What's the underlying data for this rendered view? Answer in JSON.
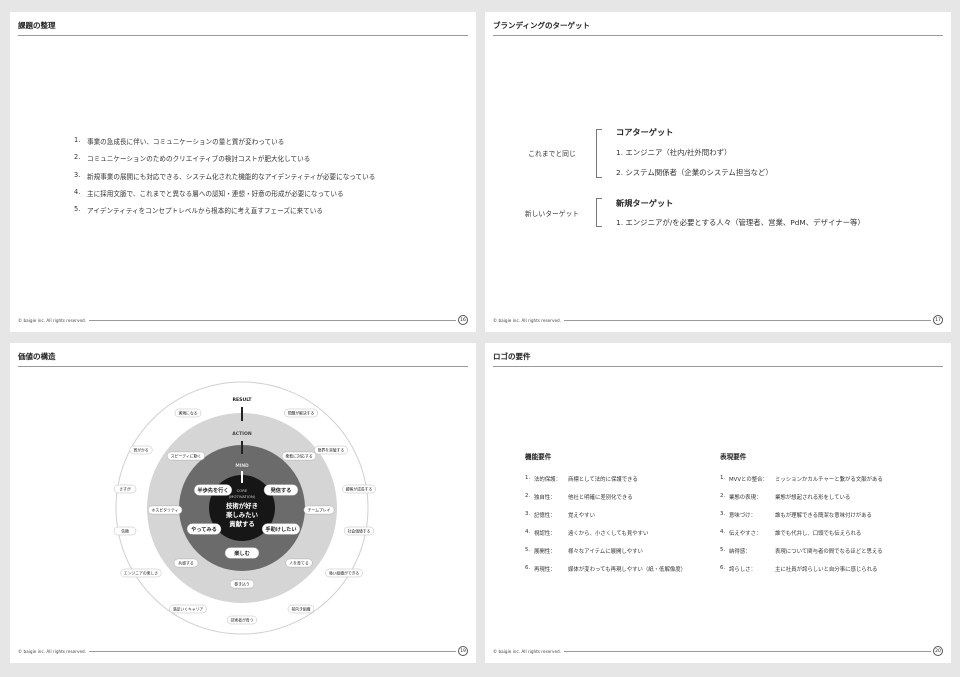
{
  "copyright": "© baigie inc. All rights reserved.",
  "slide16": {
    "title": "課題の整理",
    "page": "16",
    "items": [
      {
        "num": "1.",
        "text": "事業の急成長に伴い、コミュニケーションの量と質が変わっている"
      },
      {
        "num": "2.",
        "text": "コミュニケーションのためのクリエイティブの検討コストが肥大化している"
      },
      {
        "num": "3.",
        "text": "新規事業の展開にも対応できる、システム化された機能的なアイデンティティが必要になっている"
      },
      {
        "num": "4.",
        "text": "主に採用文脈で、これまでと異なる層への認知・連想・好意の形成が必要になっている"
      },
      {
        "num": "5.",
        "text": "アイデンティティをコンセプトレベルから根本的に考え直すフェーズに来ている"
      }
    ]
  },
  "slide17": {
    "title": "ブランディングのターゲット",
    "page": "17",
    "seg1_label": "これまでと同じ",
    "seg2_label": "新しいターゲット",
    "core_head": "コアターゲット",
    "core_items": [
      "1.  エンジニア（社内/社外問わず）",
      "2.  システム関係者（企業のシステム担当など）"
    ],
    "new_head": "新規ターゲット",
    "new_items": [
      "1.  エンジニアが/を必要とする人々（管理者、営業、PdM、デザイナー等）"
    ]
  },
  "slide19": {
    "title": "価値の構造",
    "page": "19",
    "ring_labels": {
      "result": "RESULT",
      "action": "ACTION",
      "mind": "MIND"
    },
    "core": {
      "label1": "CORE",
      "label2": "(MOTIVATION)",
      "line1": "技術が好き",
      "line2": "楽しみたい",
      "line3": "貢献する"
    },
    "mind_pills": [
      "半歩先を行く",
      "発信する",
      "やってみる",
      "手助けしたい",
      "楽しむ"
    ],
    "action_pills": [
      "スピーディに動く",
      "柔軟に対応する",
      "ホスピタリティ",
      "チームプレイ",
      "共感する",
      "人を育てる",
      "巻き込う"
    ],
    "result_pills": [
      "実現になる",
      "問題が解決する",
      "賞がかる",
      "限界を突破する",
      "さすが",
      "顧客が成長する",
      "信頼",
      "社会価値する",
      "エンジニアの楽しさ",
      "強い組織ができる",
      "満足いくキャリア",
      "前向き組織",
      "技術者が育つ"
    ]
  },
  "slide20": {
    "title": "ロゴの要件",
    "page": "20",
    "func_head": "機能要件",
    "func_items": [
      {
        "num": "1.",
        "key": "法的保護：",
        "val": "商標として法的に保護できる"
      },
      {
        "num": "2.",
        "key": "独自性：",
        "val": "他社と明確に差別化できる"
      },
      {
        "num": "3.",
        "key": "記憶性：",
        "val": "覚えやすい"
      },
      {
        "num": "4.",
        "key": "視認性：",
        "val": "遠くから、小さくしても見やすい"
      },
      {
        "num": "5.",
        "key": "展開性：",
        "val": "様々なアイテムに展開しやすい"
      },
      {
        "num": "6.",
        "key": "再現性：",
        "val": "媒体が変わっても再現しやすい（紙・低解像度）"
      }
    ],
    "expr_head": "表現要件",
    "expr_items": [
      {
        "num": "1.",
        "key": "MVVとの整合：",
        "val": "ミッションかカルチャーと繋がる文脈がある"
      },
      {
        "num": "2.",
        "key": "業態の表現：",
        "val": "業態が想起される形をしている"
      },
      {
        "num": "3.",
        "key": "意味づけ：",
        "val": "誰もが理解できる簡潔な意味付けがある"
      },
      {
        "num": "4.",
        "key": "伝えやすさ：",
        "val": "誰でも代弁し、口頭でも伝えられる"
      },
      {
        "num": "5.",
        "key": "納得感：",
        "val": "表現について関与者の間でなるほどと思える"
      },
      {
        "num": "6.",
        "key": "誇らしさ：",
        "val": "主に社員が誇らしいと自分事に感じられる"
      }
    ]
  }
}
